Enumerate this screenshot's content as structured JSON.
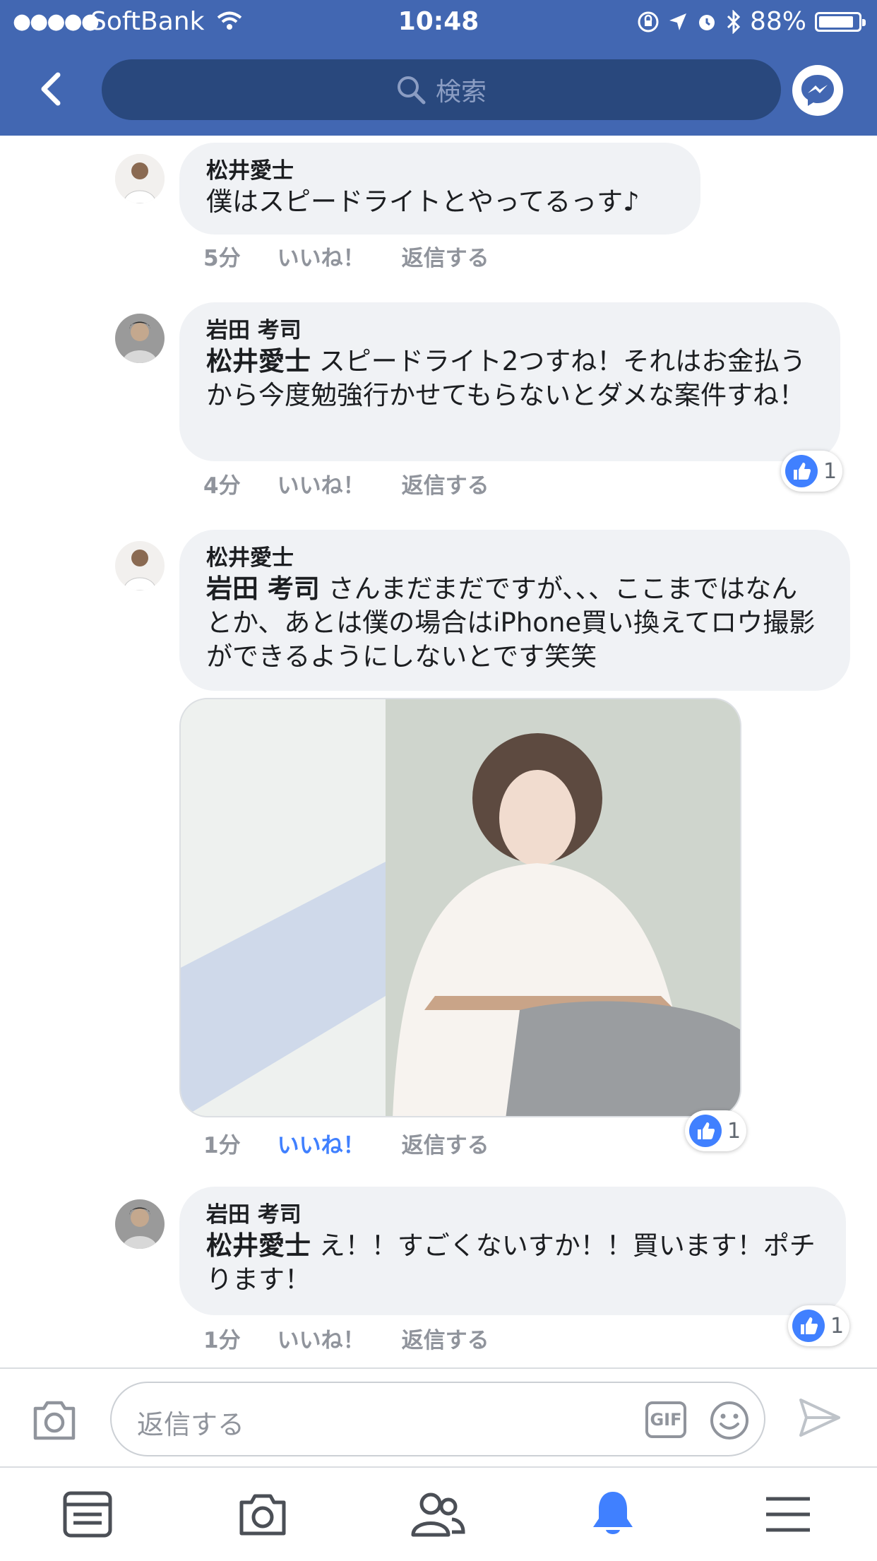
{
  "status_bar": {
    "signal": "●●●●●",
    "carrier": "SoftBank",
    "time": "10:48",
    "battery": "88%",
    "battery_level": 0.88
  },
  "nav": {
    "search_placeholder": "検索"
  },
  "comments": [
    {
      "author": "松井愛士",
      "mention": "",
      "text": "僕はスピードライトとやってるっす♪",
      "time": "5分",
      "like_label": "いいね！",
      "reply_label": "返信する",
      "reactions": ""
    },
    {
      "author": "岩田 考司",
      "mention": "松井愛士",
      "text": " スピードライト2つすね！それはお金払うから今度勉強行かせてもらないとダメな案件すね！",
      "time": "4分",
      "like_label": "いいね！",
      "reply_label": "返信する",
      "reactions": "1"
    },
    {
      "author": "松井愛士",
      "mention": "岩田 考司",
      "text": " さんまだまだですが、、、ここまではなんとか、あとは僕の場合はiPhone買い換えてロウ撮影ができるようにしないとです笑笑",
      "time": "1分",
      "like_label": "いいね！",
      "like_active": true,
      "reply_label": "返信する",
      "reactions": "1"
    },
    {
      "author": "岩田 考司",
      "mention": "松井愛士",
      "text": " え！！すごくないすか！！買います！ポチります！",
      "time": "1分",
      "like_label": "いいね！",
      "reply_label": "返信する",
      "reactions": "1"
    }
  ],
  "composer": {
    "placeholder": "返信する",
    "gif_label": "GIF"
  },
  "colors": {
    "brand": "#4267b2",
    "like_blue": "#4080ff",
    "bubble": "#f0f2f5",
    "meta_gray": "#90949c"
  },
  "icons": [
    "back-chevron-icon",
    "search-icon",
    "messenger-icon",
    "camera-icon",
    "gif-icon",
    "emoji-icon",
    "send-icon",
    "news-feed-icon",
    "camera-tab-icon",
    "friends-icon",
    "notifications-bell-icon",
    "menu-icon",
    "like-icon"
  ]
}
